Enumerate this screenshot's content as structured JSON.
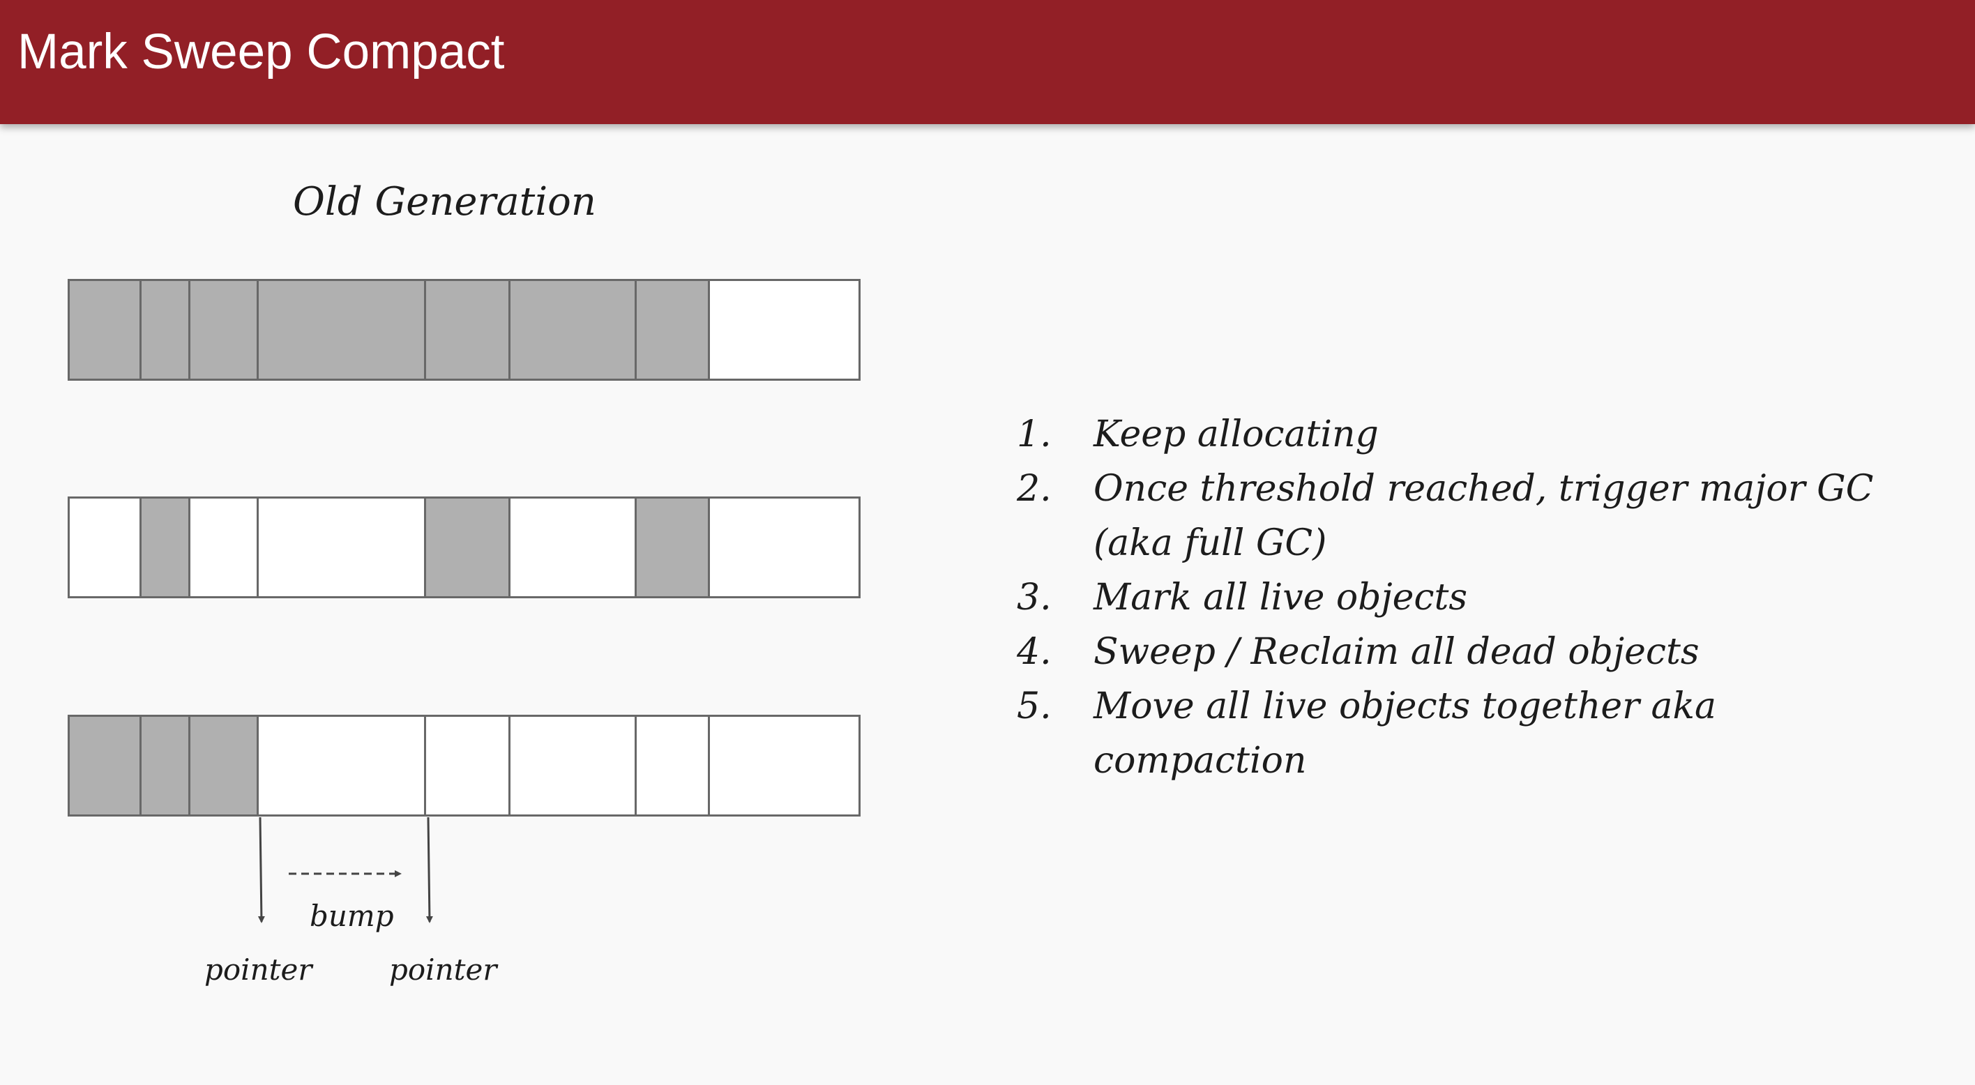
{
  "header": {
    "title": "Mark Sweep Compact",
    "background": "#921f26"
  },
  "diagram": {
    "title": "Old Generation",
    "colors": {
      "live": "#b0b0b0",
      "free": "#ffffff",
      "border": "#686868"
    },
    "rows": [
      {
        "cells": [
          "live",
          "live",
          "live",
          "live",
          "live",
          "live",
          "live",
          "free"
        ]
      },
      {
        "cells": [
          "free",
          "live",
          "free",
          "free",
          "live",
          "free",
          "live",
          "free"
        ]
      },
      {
        "cells": [
          "live",
          "live",
          "live",
          "free",
          "free",
          "free",
          "free",
          "free"
        ]
      }
    ],
    "bump_label": "bump",
    "pointer_left_label": "pointer",
    "pointer_right_label": "pointer"
  },
  "steps": [
    {
      "num": "1.",
      "text": "Keep allocating"
    },
    {
      "num": "2.",
      "text": "Once threshold reached, trigger major GC (aka full GC)"
    },
    {
      "num": "3.",
      "text": "Mark all live objects"
    },
    {
      "num": "4.",
      "text": "Sweep / Reclaim all dead objects"
    },
    {
      "num": "5.",
      "text": "Move all live objects together aka compaction"
    }
  ]
}
